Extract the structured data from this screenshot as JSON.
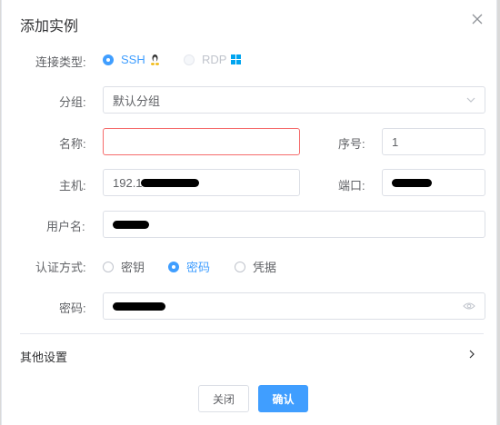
{
  "dialog": {
    "title": "添加实例"
  },
  "form": {
    "conn_type": {
      "label": "连接类型:",
      "options": [
        {
          "label": "SSH",
          "icon": "linux-icon"
        },
        {
          "label": "RDP",
          "icon": "windows-icon"
        }
      ],
      "selected": "SSH"
    },
    "group": {
      "label": "分组:",
      "value": "默认分组"
    },
    "name": {
      "label": "名称:",
      "value": ""
    },
    "order": {
      "label": "序号:",
      "value": "1"
    },
    "host": {
      "label": "主机:",
      "value_visible": "192.1"
    },
    "port": {
      "label": "端口:"
    },
    "username": {
      "label": "用户名:"
    },
    "auth": {
      "label": "认证方式:",
      "options": [
        "密钥",
        "密码",
        "凭据"
      ],
      "selected": "密码"
    },
    "password": {
      "label": "密码:"
    }
  },
  "other_settings": {
    "label": "其他设置"
  },
  "footer": {
    "close_label": "关闭",
    "confirm_label": "确认"
  },
  "colors": {
    "accent": "#409eff",
    "error": "#f56c6c",
    "border": "#dcdfe6"
  }
}
